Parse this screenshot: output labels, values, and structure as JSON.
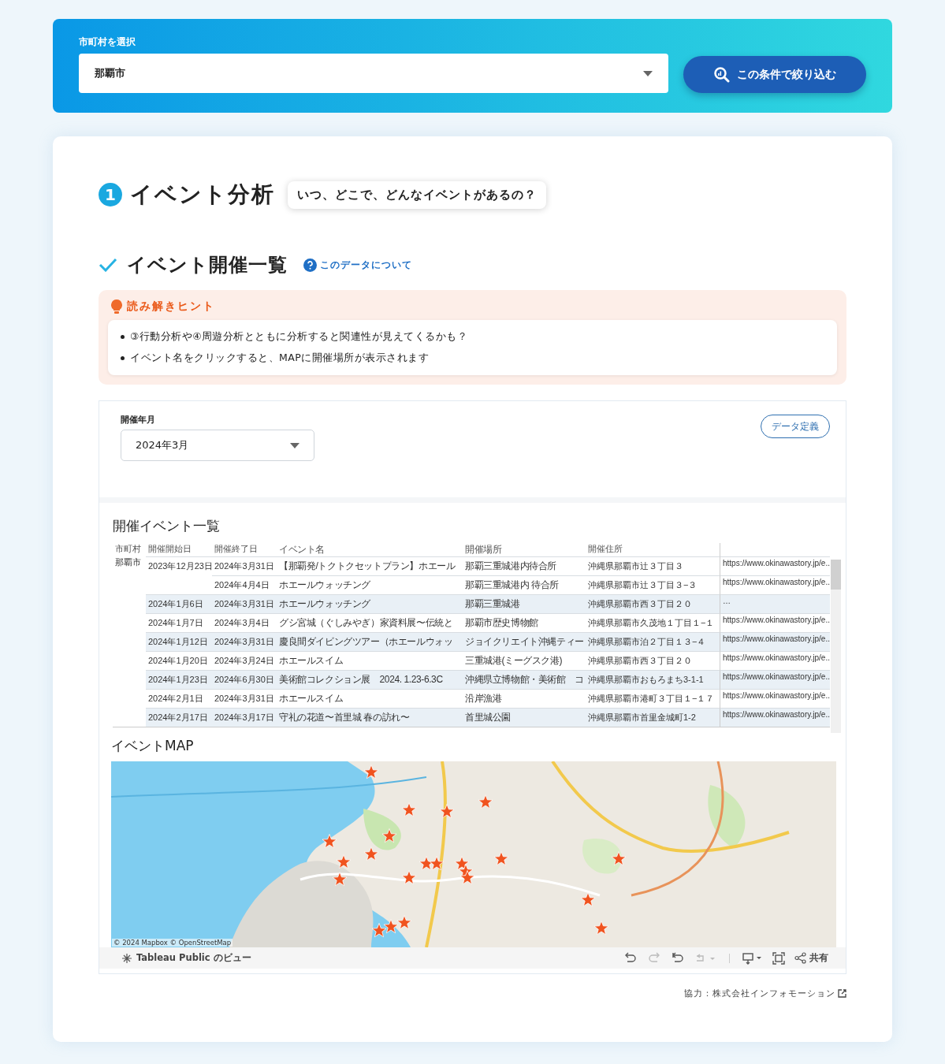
{
  "filter_bar": {
    "label": "市町村を選択",
    "select": {
      "value": "那覇市"
    },
    "button": "この条件で絞り込む"
  },
  "section": {
    "number": "1",
    "title": "イベント分析",
    "bubble": "いつ、どこで、どんなイベントがあるの？"
  },
  "subsection": {
    "title": "イベント開催一覧",
    "help_link": "このデータについて"
  },
  "hints": {
    "title": "読み解きヒント",
    "items": [
      "③行動分析や④周遊分析とともに分析すると関連性が見えてくるかも？",
      "イベント名をクリックすると、MAPに開催場所が表示されます"
    ]
  },
  "embed": {
    "month_filter": {
      "label": "開催年月",
      "value": "2024年3月"
    },
    "definition_button": "データ定義",
    "table": {
      "title": "開催イベント一覧",
      "columns": [
        "市町村",
        "開催開始日",
        "開催終了日",
        "イベント名",
        "開催場所",
        "開催住所"
      ],
      "rows": [
        {
          "city": "那覇市",
          "start": "2023年12月23日",
          "end": "2024年3月31日",
          "name": "【那覇発/トクトクセットプラン】ホエール",
          "place": "那覇三重城港内待合所",
          "address": "沖縄県那覇市辻３丁目３",
          "column_7": "https://www.okinawastory.jp/e.."
        },
        {
          "end": "2024年4月4日",
          "name": "ホエールウォッチング",
          "place": "那覇三重城港内 待合所",
          "address": "沖縄県那覇市辻３丁目３−３",
          "column_7": "https://www.okinawastory.jp/e.."
        },
        {
          "start": "2024年1月6日",
          "end": "2024年3月31日",
          "name": "ホエールウォッチング",
          "place": "那覇三重城港",
          "address": "沖縄県那覇市西３丁目２０",
          "column_7": "…"
        },
        {
          "start": "2024年1月7日",
          "end": "2024年3月4日",
          "name": "グシ宮城（ぐしみやぎ）家資料展〜伝統と",
          "place": "那覇市歴史博物館",
          "address": "沖縄県那覇市久茂地１丁目１−１",
          "column_7": "https://www.okinawastory.jp/e.."
        },
        {
          "start": "2024年1月12日",
          "end": "2024年3月31日",
          "name": "慶良間ダイビングツアー（ホエールウォッ",
          "place": "ジョイクリエイト沖縄ティー",
          "address": "沖縄県那覇市泊２丁目１３−４",
          "column_7": "https://www.okinawastory.jp/e.."
        },
        {
          "start": "2024年1月20日",
          "end": "2024年3月24日",
          "name": "ホエールスイム",
          "place": "三重城港(ミーグスク港)",
          "address": "沖縄県那覇市西３丁目２０",
          "column_7": "https://www.okinawastory.jp/e.."
        },
        {
          "start": "2024年1月23日",
          "end": "2024年6月30日",
          "name": "美術館コレクション展　2024. 1.23-6.3C",
          "place": "沖縄県立博物館・美術館　コ",
          "address": "沖縄県那覇市おもろまち3-1-1",
          "column_7": "https://www.okinawastory.jp/e.."
        },
        {
          "start": "2024年2月1日",
          "end": "2024年3月31日",
          "name": "ホエールスイム",
          "place": "沿岸漁港",
          "address": "沖縄県那覇市港町３丁目１−１７",
          "column_7": "https://www.okinawastory.jp/e.."
        },
        {
          "start": "2024年2月17日",
          "end": "2024年3月17日",
          "name": "守礼の花道〜首里城 春の訪れ〜",
          "place": "首里城公園",
          "address": "沖縄県那覇市首里金城町1-2",
          "column_7": "https://www.okinawastory.jp/e.."
        }
      ]
    },
    "map": {
      "title": "イベントMAP",
      "kind": "picture",
      "attribution": "© 2024 Mapbox © OpenStreetMap"
    },
    "toolbar": {
      "brand": "Tableau Public のビュー",
      "share": "共有"
    }
  },
  "credit": "協力：株式会社インフォモーション"
}
